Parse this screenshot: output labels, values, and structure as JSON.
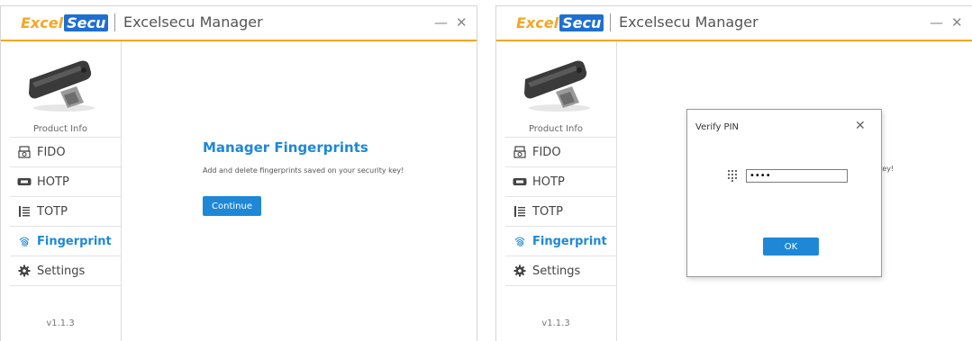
{
  "app": {
    "logo_part1": "Excel",
    "logo_part2": "Secu",
    "title": "Excelsecu Manager",
    "minimize_glyph": "—",
    "close_glyph": "✕"
  },
  "sidebar": {
    "product_info": "Product Info",
    "items": [
      {
        "label": "FIDO",
        "icon": "fido-key-icon"
      },
      {
        "label": "HOTP",
        "icon": "hotp-token-icon"
      },
      {
        "label": "TOTP",
        "icon": "totp-list-icon"
      },
      {
        "label": "Fingerprint",
        "icon": "fingerprint-icon"
      },
      {
        "label": "Settings",
        "icon": "gear-icon"
      }
    ],
    "active_item": "Fingerprint",
    "version": "v1.1.3"
  },
  "main": {
    "title": "Manager Fingerprints",
    "description": "Add and delete fingerprints saved on your security key!",
    "continue_label": "Continue",
    "partial_visible_text": "key!"
  },
  "dialog": {
    "title": "Verify PIN",
    "close_glyph": "✕",
    "pin_value": "••••",
    "ok_label": "OK"
  },
  "colors": {
    "accent_orange": "#f5a623",
    "accent_blue": "#1e88d7",
    "logo_blue": "#1f6fd1"
  }
}
